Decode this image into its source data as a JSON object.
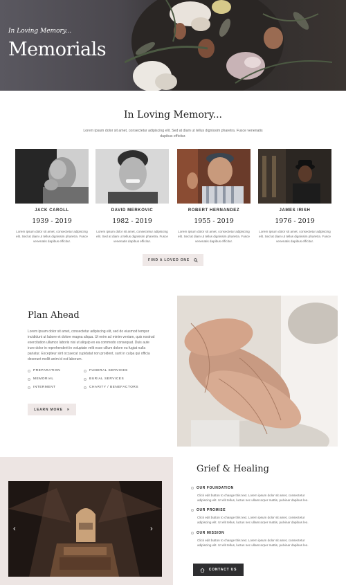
{
  "hero": {
    "subtitle": "In Loving Memory...",
    "title": "Memorials"
  },
  "memory": {
    "heading": "In Loving Memory...",
    "intro": "Lorem ipsum dolor sit amet, consectetur adipiscing elit. Sed at diam ut tellus dignissim pharetra. Fusce venenatis dapibus efficitur.",
    "people": [
      {
        "name": "JACK CAROLL",
        "years": "1939 - 2019",
        "bio": "Lorem ipsum dolor sit amet, consectetur adipiscing elit. Sed at diam ut tellus dignissim pharetra. Fusce venenatis dapibus efficitur."
      },
      {
        "name": "DAVID MERKOVIC",
        "years": "1982 - 2019",
        "bio": "Lorem ipsum dolor sit amet, consectetur adipiscing elit. Sed at diam ut tellus dignissim pharetra. Fusce venenatis dapibus efficitur."
      },
      {
        "name": "ROBERT HERNANDEZ",
        "years": "1955 - 2019",
        "bio": "Lorem ipsum dolor sit amet, consectetur adipiscing elit. Sed at diam ut tellus dignissim pharetra. Fusce venenatis dapibus efficitur."
      },
      {
        "name": "JAMES IRISH",
        "years": "1976 - 2019",
        "bio": "Lorem ipsum dolor sit amet, consectetur adipiscing elit. Sed at diam ut tellus dignissim pharetra. Fusce venenatis dapibus efficitur."
      }
    ],
    "find_button": "FIND A LOVED ONE"
  },
  "plan": {
    "title": "Plan Ahead",
    "text": "Lorem ipsum dolor sit amet, consectetur adipiscing elit, sed do eiusmod tempor incididunt ut labore et dolore magna aliqua. Ut enim ad minim veniam, quis nostrud exercitation ullamco laboris nisi ut aliquip ex ea commodo consequat. Duis aute irure dolor in reprehenderit in voluptate velit esse cillum dolore eu fugiat nulla pariatur. Excepteur sint occaecat cupidatat non proident, sunt in culpa qui officia deserunt mollit anim id est laborum.",
    "services": [
      "PREPARATION",
      "FUNERAL SERVICES",
      "MEMORIAL",
      "BURIAL SERVICES",
      "INTERMENT",
      "CHARITY / BENEFACTORS"
    ],
    "learn_button": "LEARN MORE"
  },
  "grief": {
    "title": "Grief & Healing",
    "items": [
      {
        "heading": "OUR FOUNDATION",
        "text": "Click edit button to change this text. Lorem ipsum dolor sit amet, consectetur adipiscing elit. Ut elit tellus, luctus nec ullamcorper mattis, pulvinar dapibus leo."
      },
      {
        "heading": "OUR PROMISE",
        "text": "Click edit button to change this text. Lorem ipsum dolor sit amet, consectetur adipiscing elit. Ut elit tellus, luctus nec ullamcorper mattis, pulvinar dapibus leo."
      },
      {
        "heading": "OUR MISSION",
        "text": "Click edit button to change this text. Lorem ipsum dolor sit amet, consectetur adipiscing elit. Ut elit tellus, luctus nec ullamcorper mattis, pulvinar dapibus leo."
      }
    ],
    "contact_button": "CONTACT US"
  },
  "colors": {
    "accent_bg": "#efe8e7",
    "dark_button": "#2e2e30",
    "panel": "#ede5e3"
  }
}
